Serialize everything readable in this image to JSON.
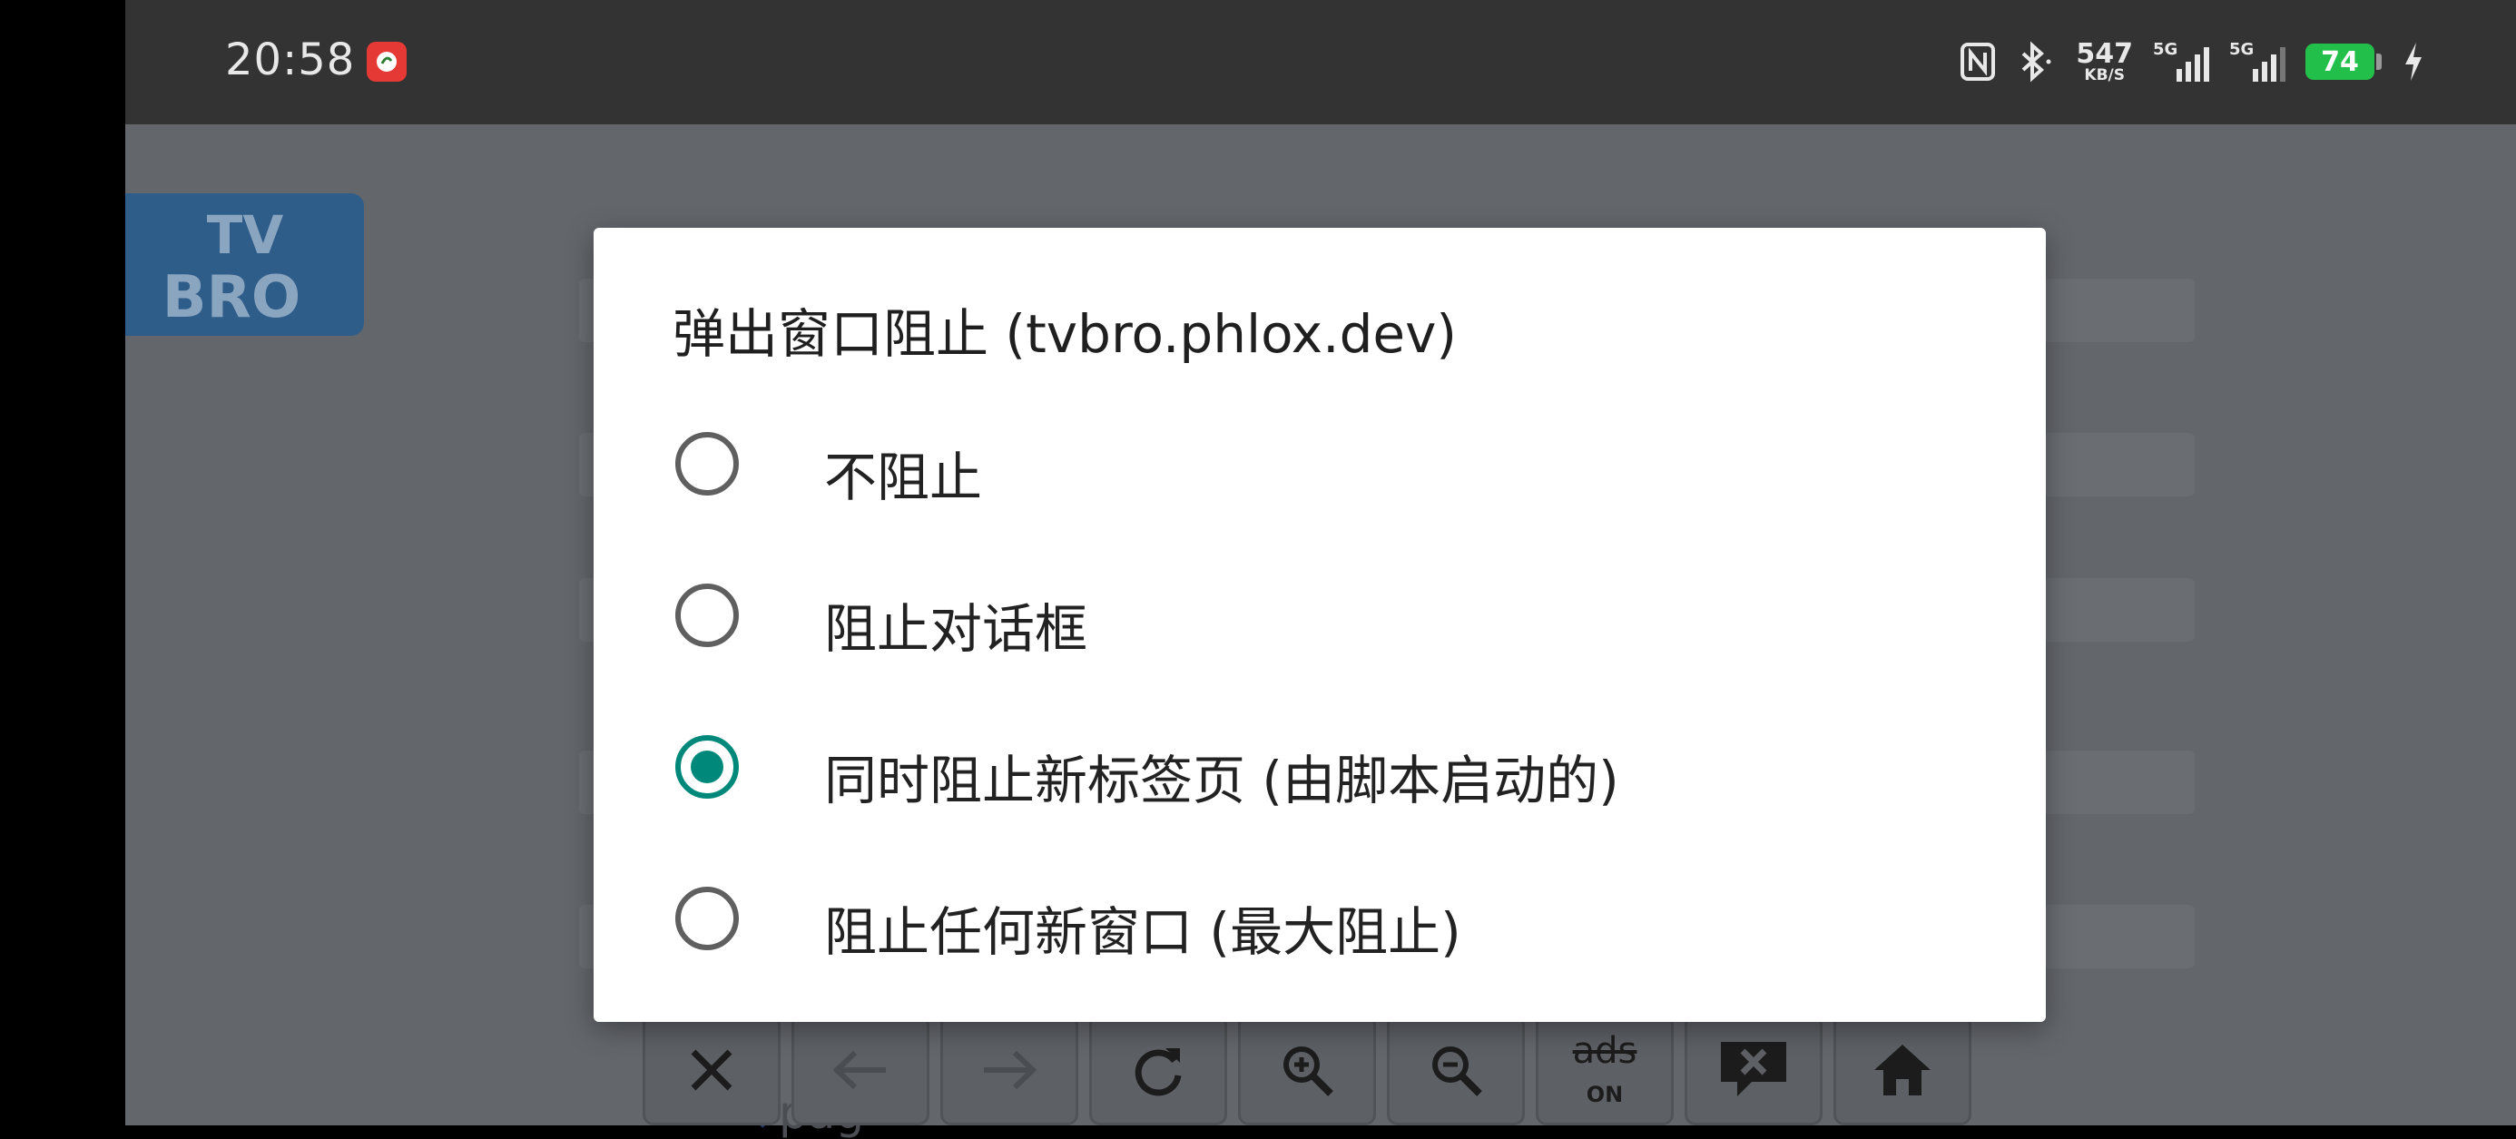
{
  "status_bar": {
    "time": "20:58",
    "net_speed_value": "547",
    "net_speed_unit": "KB/S",
    "sim1_label": "5G",
    "sim2_label": "5G",
    "battery_level": "74",
    "icons": [
      "nfc-icon",
      "bluetooth-icon",
      "signal-icon",
      "battery-icon",
      "charging-icon"
    ]
  },
  "browser": {
    "logo_text_top": "TV",
    "logo_text_bottom": "BRO",
    "toolbar": [
      {
        "name": "close-icon"
      },
      {
        "name": "back-arrow-icon"
      },
      {
        "name": "forward-arrow-icon"
      },
      {
        "name": "refresh-icon"
      },
      {
        "name": "zoom-in-icon"
      },
      {
        "name": "zoom-out-icon"
      },
      {
        "name": "ads-toggle",
        "label": "ads",
        "sub": "ON"
      },
      {
        "name": "popup-block-icon"
      },
      {
        "name": "home-icon"
      }
    ],
    "search_partial": "pag"
  },
  "dialog": {
    "title": "弹出窗口阻止 (tvbro.phlox.dev)",
    "options": [
      {
        "label": "不阻止",
        "checked": false
      },
      {
        "label": "阻止对话框",
        "checked": false
      },
      {
        "label": "同时阻止新标签页 (由脚本启动的)",
        "checked": true
      },
      {
        "label": "阻止任何新窗口 (最大阻止)",
        "checked": false
      }
    ]
  },
  "colors": {
    "accent": "#00897b",
    "status_bar_bg": "#333333",
    "scrim": "#63666b",
    "battery": "#22c04a"
  }
}
